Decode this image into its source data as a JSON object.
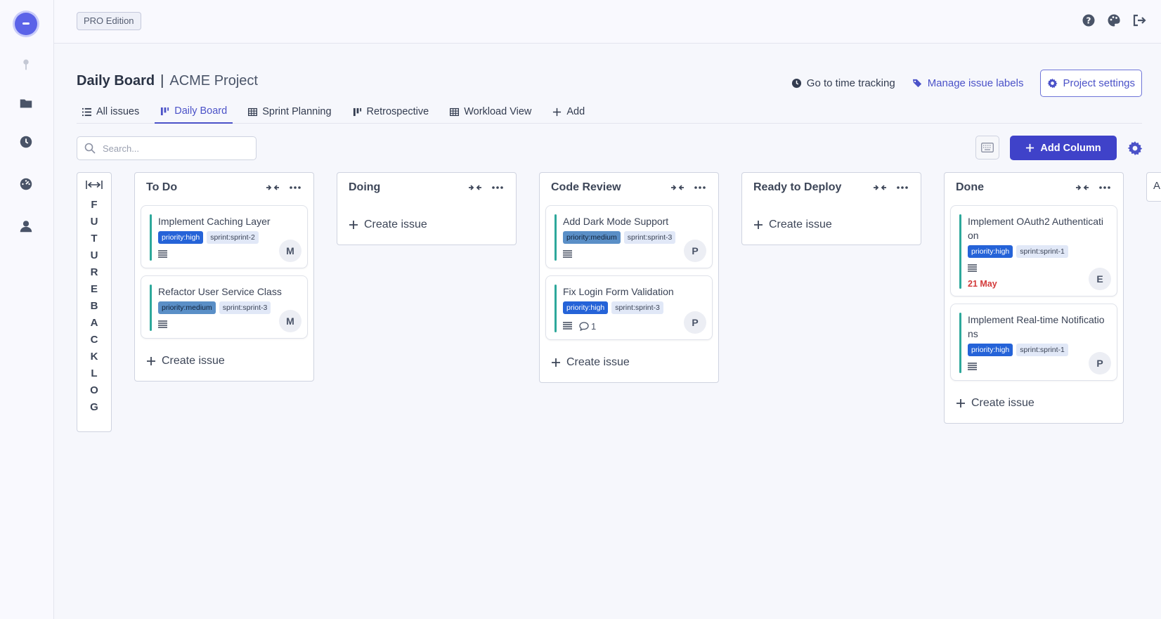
{
  "app": {
    "edition_badge": "PRO Edition"
  },
  "sidebar": {
    "items": [
      {
        "icon": "pin-icon"
      },
      {
        "icon": "folder-icon"
      },
      {
        "icon": "clock-icon"
      },
      {
        "icon": "dashboard-icon"
      },
      {
        "icon": "user-icon"
      }
    ]
  },
  "topbar": {
    "icons": [
      "help-icon",
      "palette-icon",
      "logout-icon"
    ]
  },
  "header": {
    "board_name": "Daily Board",
    "separator": "|",
    "project_name": "ACME Project",
    "time_tracking": "Go to time tracking",
    "manage_labels": "Manage issue labels",
    "project_settings": "Project settings"
  },
  "tabs": [
    {
      "label": "All issues",
      "active": false
    },
    {
      "label": "Daily Board",
      "active": true
    },
    {
      "label": "Sprint Planning",
      "active": false
    },
    {
      "label": "Retrospective",
      "active": false
    },
    {
      "label": "Workload View",
      "active": false
    },
    {
      "label": "Add",
      "active": false
    }
  ],
  "toolbar": {
    "search_placeholder": "Search...",
    "add_column": "Add Column"
  },
  "backlog": {
    "letters": [
      "F",
      "U",
      "T",
      "U",
      "R",
      "E",
      "B",
      "A",
      "C",
      "K",
      "L",
      "O",
      "G"
    ]
  },
  "columns": [
    {
      "title": "To Do",
      "cards": [
        {
          "title": "Implement Caching Layer",
          "priority": "priority:high",
          "sprint": "sprint:sprint-2",
          "assignee": "M",
          "comments": "",
          "due": ""
        },
        {
          "title": "Refactor User Service Class",
          "priority": "priority:medium",
          "sprint": "sprint:sprint-3",
          "assignee": "M",
          "comments": "",
          "due": ""
        }
      ],
      "create_label": "Create issue"
    },
    {
      "title": "Doing",
      "cards": [],
      "create_label": "Create issue"
    },
    {
      "title": "Code Review",
      "cards": [
        {
          "title": "Add Dark Mode Support",
          "priority": "priority:medium",
          "sprint": "sprint:sprint-3",
          "assignee": "P",
          "comments": "",
          "due": ""
        },
        {
          "title": "Fix Login Form Validation",
          "priority": "priority:high",
          "sprint": "sprint:sprint-3",
          "assignee": "P",
          "comments": "1",
          "due": ""
        }
      ],
      "create_label": "Create issue"
    },
    {
      "title": "Ready to Deploy",
      "cards": [],
      "create_label": "Create issue"
    },
    {
      "title": "Done",
      "cards": [
        {
          "title": "Implement OAuth2 Authentication",
          "priority": "priority:high",
          "sprint": "sprint:sprint-1",
          "assignee": "E",
          "comments": "",
          "due": "21 May"
        },
        {
          "title": "Implement Real-time Notifications",
          "priority": "priority:high",
          "sprint": "sprint:sprint-1",
          "assignee": "P",
          "comments": "",
          "due": ""
        }
      ],
      "create_label": "Create issue"
    }
  ],
  "cut_column_initial": "A",
  "colors": {
    "accent": "#4b52c8",
    "primary_button": "#3f42c9",
    "card_stripe": "#2ea89b",
    "priority_high": "#2563d8",
    "priority_medium": "#5a8fc7",
    "due_date": "#d33a3a"
  }
}
